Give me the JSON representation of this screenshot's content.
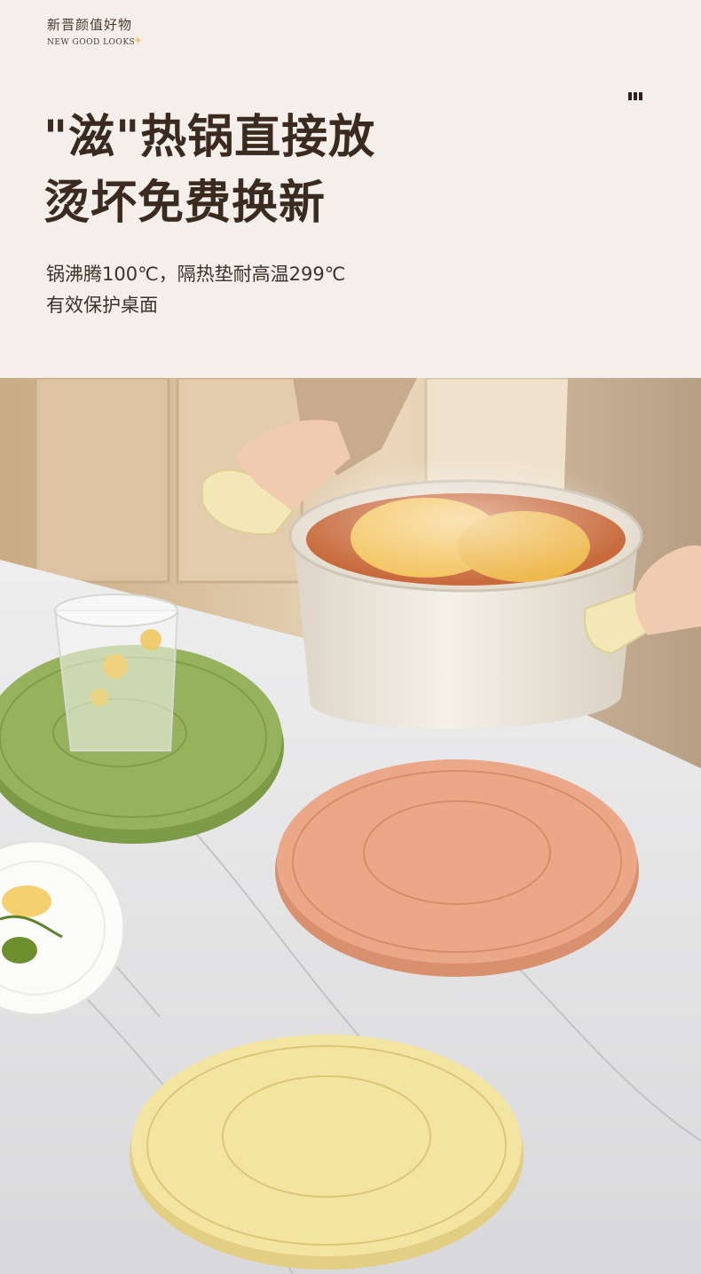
{
  "header": {
    "brand_cn": "新晋颜值好物",
    "brand_en": "NEW GOOD LOOKS",
    "sparkle_icon": "sparkle-icon",
    "menu_icon": "bars-icon",
    "headline_line1": "\"滋\"热锅直接放",
    "headline_line2": "烫坏免费换新",
    "subline_line1": "锅沸腾100℃，隔热垫耐高温299℃",
    "subline_line2": "有效保护桌面"
  },
  "colors": {
    "background": "#f4efea",
    "headline": "#3a2a20",
    "mat_green": "#93b05a",
    "mat_pink": "#e8a888",
    "mat_yellow": "#f2e3a0",
    "pot_cream": "#f1ebe2"
  }
}
